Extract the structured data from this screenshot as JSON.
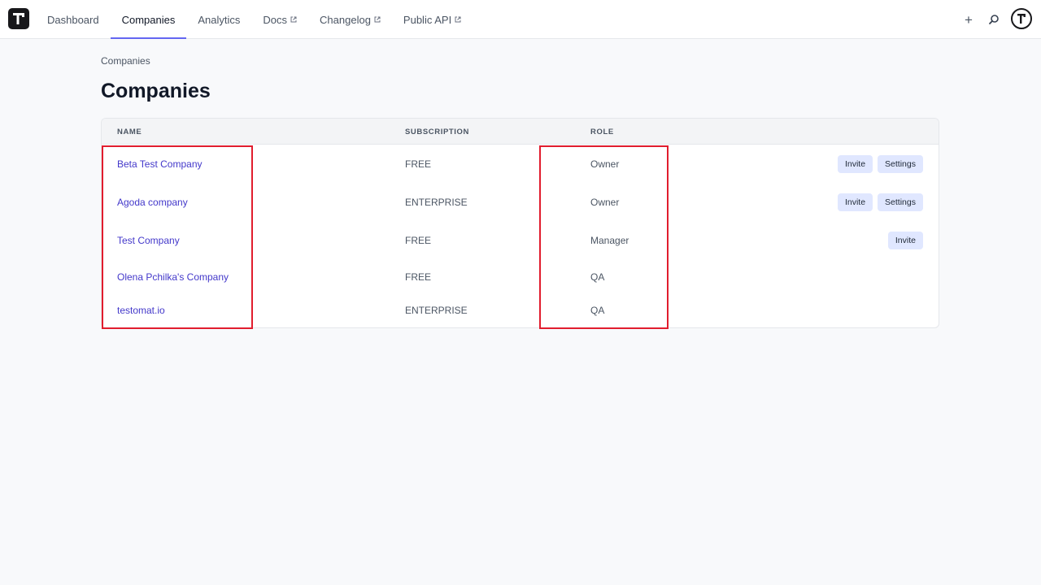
{
  "nav": {
    "items": [
      {
        "label": "Dashboard",
        "active": false,
        "external": false
      },
      {
        "label": "Companies",
        "active": true,
        "external": false
      },
      {
        "label": "Analytics",
        "active": false,
        "external": false
      },
      {
        "label": "Docs",
        "active": false,
        "external": true
      },
      {
        "label": "Changelog",
        "active": false,
        "external": true
      },
      {
        "label": "Public API",
        "active": false,
        "external": true
      }
    ],
    "plus_label": "+",
    "accent_color": "#6366f1"
  },
  "breadcrumb": {
    "current": "Companies"
  },
  "page_title": "Companies",
  "table": {
    "headers": {
      "name": "NAME",
      "subscription": "SUBSCRIPTION",
      "role": "ROLE"
    },
    "rows": [
      {
        "name": "Beta Test Company",
        "subscription": "FREE",
        "role": "Owner",
        "actions": [
          "Invite",
          "Settings"
        ]
      },
      {
        "name": "Agoda company",
        "subscription": "ENTERPRISE",
        "role": "Owner",
        "actions": [
          "Invite",
          "Settings"
        ]
      },
      {
        "name": "Test Company",
        "subscription": "FREE",
        "role": "Manager",
        "actions": [
          "Invite"
        ]
      },
      {
        "name": "Olena Pchilka's Company",
        "subscription": "FREE",
        "role": "QA",
        "actions": []
      },
      {
        "name": "testomat.io",
        "subscription": "ENTERPRISE",
        "role": "QA",
        "actions": []
      }
    ]
  },
  "highlight_color": "#e11d2e",
  "link_color": "#4338ca"
}
